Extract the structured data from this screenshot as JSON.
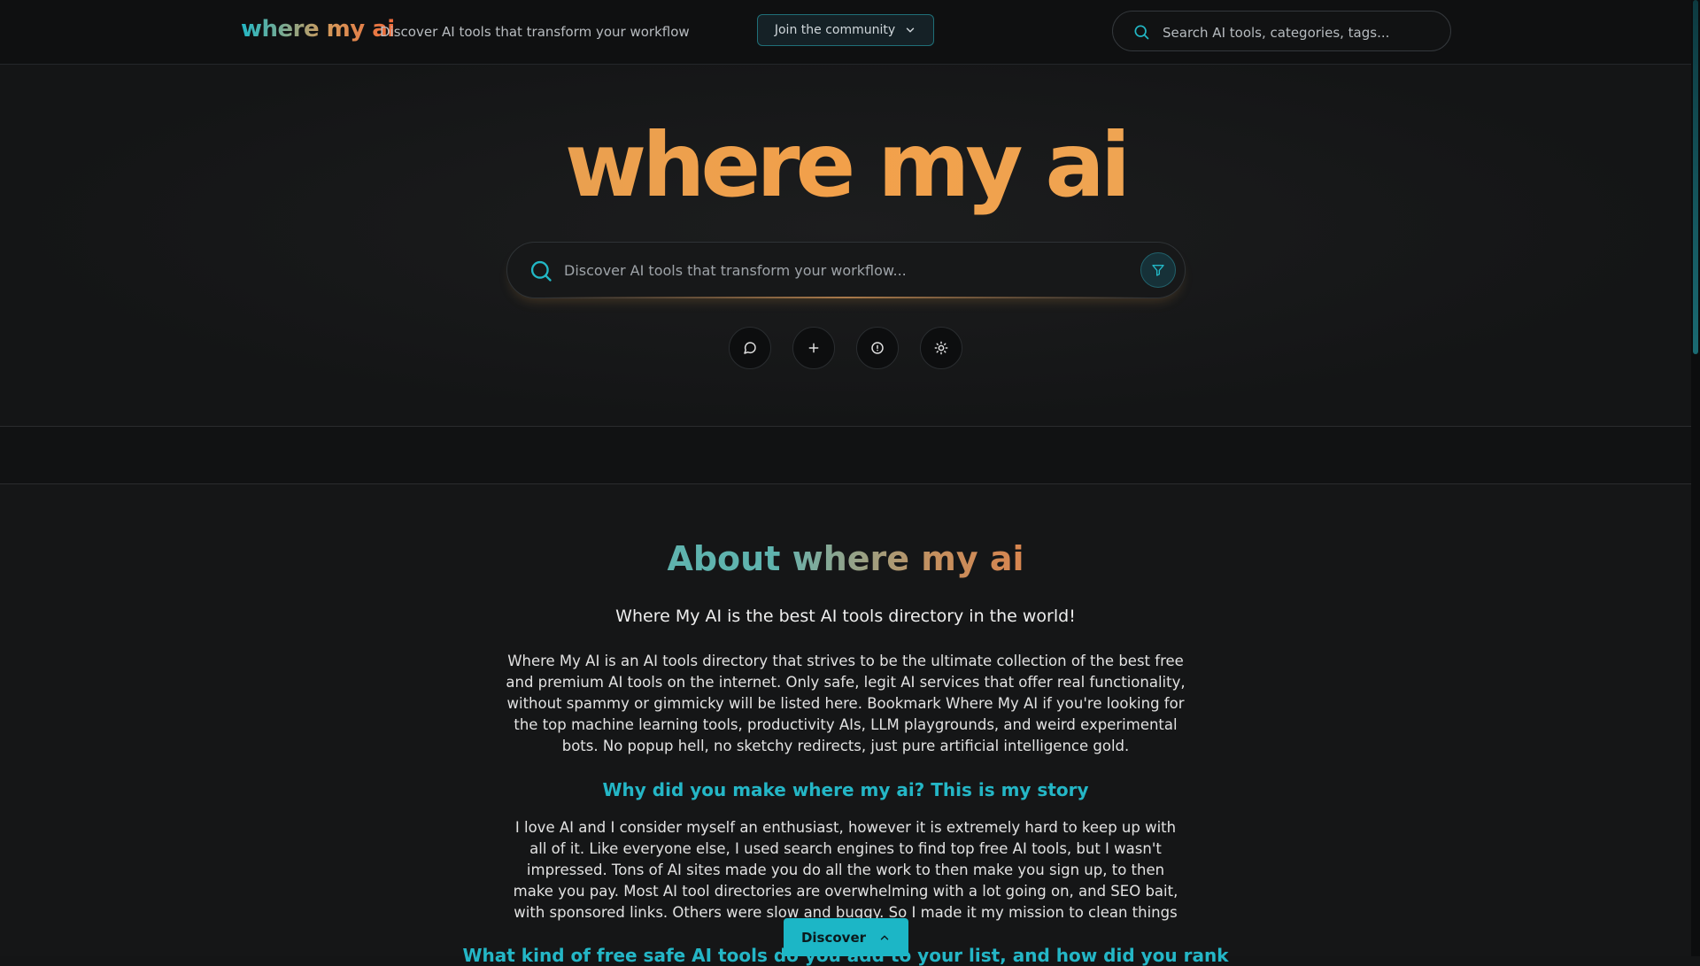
{
  "header": {
    "logo": "where my ai",
    "tagline": "Discover AI tools that transform your workflow",
    "join_label": "Join the community",
    "search_placeholder": "Search AI tools, categories, tags..."
  },
  "hero": {
    "logo": "where my ai",
    "search_placeholder": "Discover AI tools that transform your workflow...",
    "actions": [
      "chat-icon",
      "plus-icon",
      "info-icon",
      "sun-icon"
    ]
  },
  "about": {
    "title_prefix": "About",
    "title_brand": "where my ai",
    "lead": "Where My AI is the best AI tools directory in the world!",
    "paragraph1": "Where My AI is an AI tools directory that strives to be the ultimate collection of the best free and premium AI tools on the internet. Only safe, legit AI services that offer real functionality, without spammy or gimmicky will be listed here. Bookmark Where My AI if you're looking for the top machine learning tools, productivity AIs, LLM playgrounds, and weird experimental bots. No popup hell, no sketchy redirects, just pure artificial intelligence gold.",
    "heading2": "Why did you make where my ai? This is my story",
    "paragraph2": "I love AI and I consider myself an enthusiast, however it is extremely hard to keep up with all of it. Like everyone else, I used search engines to find top free AI tools, but I wasn't impressed. Tons of AI sites made you do all the work to then make you sign up, to then make you pay. Most AI tool directories are overwhelming with a lot going on, and SEO bait, with sponsored links. Others were slow and buggy. So I made it my mission to clean things up.",
    "heading3": "What kind of free safe AI tools do you add to your list, and how did you rank"
  },
  "discover_label": "Discover",
  "colors": {
    "accent": "#1cb6c6",
    "brand_orange": "#f2a04a",
    "background": "#141516"
  }
}
